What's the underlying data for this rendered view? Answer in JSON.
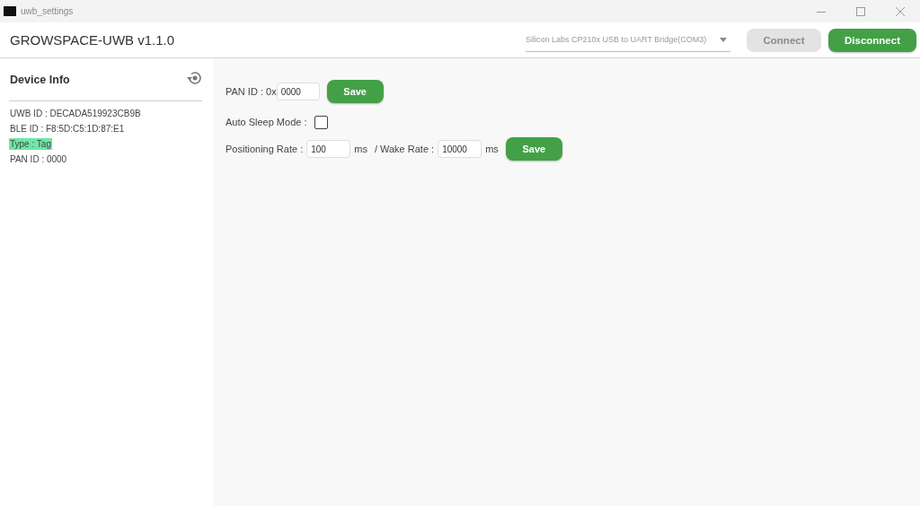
{
  "window": {
    "title": "uwb_settings"
  },
  "header": {
    "app_title": "GROWSPACE-UWB v1.1.0",
    "port_select": {
      "value": "Silicon Labs CP210x USB to UART Bridge(COM3)"
    },
    "buttons": [
      {
        "label": "Connect",
        "disabled": true
      },
      {
        "label": "Disconnect",
        "disabled": false
      }
    ]
  },
  "sidebar": {
    "title": "Device Info",
    "items": [
      {
        "text": "UWB ID : DECADA519923CB9B",
        "highlighted": false
      },
      {
        "text": "BLE ID : F8:5D:C5:1D:87:E1",
        "highlighted": false
      },
      {
        "text": "Type : Tag",
        "highlighted": true
      },
      {
        "text": "PAN ID : 0000",
        "highlighted": false
      }
    ]
  },
  "settings": {
    "pan_id": {
      "label": "PAN ID : 0x",
      "value": "0000",
      "button": "Save"
    },
    "auto_sleep": {
      "label": "Auto Sleep Mode :",
      "checked": false
    },
    "rates": {
      "positioning_label": "Positioning Rate :",
      "positioning_value": "100",
      "positioning_unit": "ms",
      "wake_label": "/ Wake Rate :",
      "wake_value": "10000",
      "wake_unit": "ms",
      "button": "Save"
    }
  }
}
